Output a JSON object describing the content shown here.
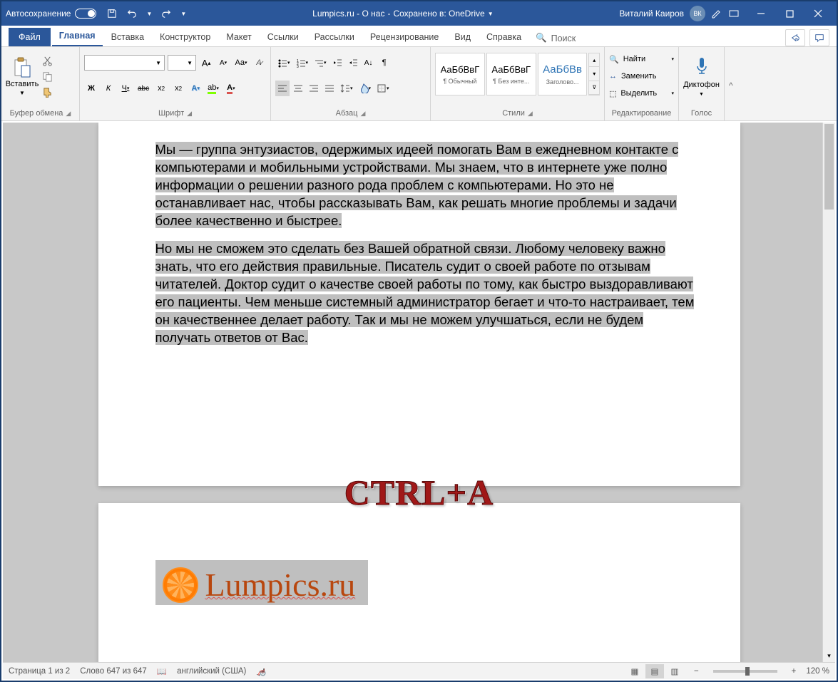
{
  "titlebar": {
    "autosave": "Автосохранение",
    "doc_name": "Lumpics.ru - О нас",
    "saved_to": "Сохранено в: OneDrive",
    "user_name": "Виталий Каиров",
    "user_initials": "ВК"
  },
  "tabs": {
    "file": "Файл",
    "items": [
      "Главная",
      "Вставка",
      "Конструктор",
      "Макет",
      "Ссылки",
      "Рассылки",
      "Рецензирование",
      "Вид",
      "Справка"
    ],
    "active_index": 0,
    "search": "Поиск"
  },
  "ribbon": {
    "clipboard": {
      "label": "Буфер обмена",
      "paste": "Вставить"
    },
    "font": {
      "label": "Шрифт",
      "name": "",
      "size": "",
      "bold": "Ж",
      "italic": "К",
      "underline": "Ч",
      "strike": "abc",
      "aa": "Aa"
    },
    "para": {
      "label": "Абзац"
    },
    "styles": {
      "label": "Стили",
      "items": [
        {
          "preview": "АаБбВвГ",
          "name": "¶ Обычный"
        },
        {
          "preview": "АаБбВвГ",
          "name": "¶ Без инте..."
        },
        {
          "preview": "АаБбВв",
          "name": "Заголово..."
        }
      ]
    },
    "editing": {
      "label": "Редактирование",
      "find": "Найти",
      "replace": "Заменить",
      "select": "Выделить"
    },
    "voice": {
      "label": "Голос",
      "dictate": "Диктофон"
    }
  },
  "document": {
    "para1": "Мы — группа энтузиастов, одержимых идеей помогать Вам в ежедневном контакте с компьютерами и мобильными устройствами. Мы знаем, что в интернете уже полно информации о решении разного рода проблем с компьютерами. Но это не останавливает нас, чтобы рассказывать Вам, как решать многие проблемы и задачи более качественно и быстрее.",
    "para2": "Но мы не сможем это сделать без Вашей обратной связи. Любому человеку важно знать, что его действия правильные. Писатель судит о своей работе по отзывам читателей. Доктор судит о качестве своей работы по тому, как быстро выздоравливают его пациенты. Чем меньше системный администратор бегает и что-то настраивает, тем он качественнее делает работу. Так и мы не можем улучшаться, если не будем получать ответов от Вас.",
    "logo_text": "Lumpics.ru"
  },
  "overlay": {
    "shortcut": "CTRL+A"
  },
  "status": {
    "page": "Страница 1 из 2",
    "words": "Слово 647 из 647",
    "lang": "английский (США)",
    "zoom": "120 %"
  }
}
